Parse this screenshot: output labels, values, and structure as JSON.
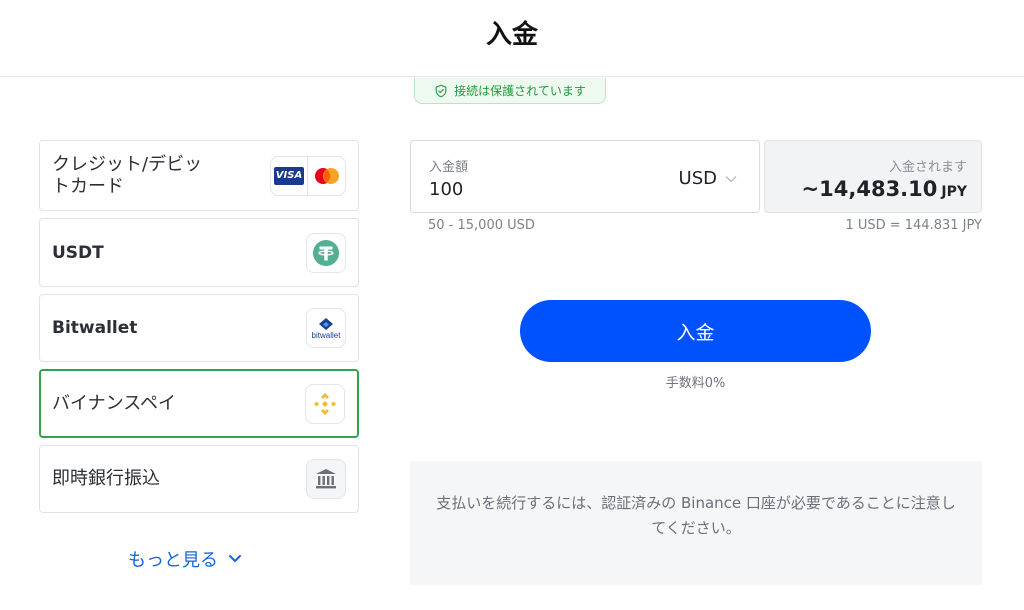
{
  "header": {
    "title": "入金"
  },
  "security": {
    "text": "接続は保護されています"
  },
  "methods": [
    {
      "label": "クレジット/デビットカード",
      "line1": "クレジット/デビッ",
      "line2": "トカード",
      "logos": [
        "visa-logo",
        "mastercard-logo"
      ]
    },
    {
      "label": "USDT",
      "logo": "tether-logo"
    },
    {
      "label": "Bitwallet",
      "logo": "bitwallet-logo",
      "logo_text": "bitwallet"
    },
    {
      "label": "バイナンスペイ",
      "logo": "binance-logo",
      "selected": true
    },
    {
      "label": "即時銀行振込",
      "logo": "bank-icon"
    }
  ],
  "cards": {
    "visa_text": "VISA"
  },
  "more": {
    "label": "もっと見る"
  },
  "amount": {
    "label": "入金額",
    "value": "100",
    "currency": "USD",
    "range": "50 - 15,000 USD"
  },
  "receive": {
    "label": "入金されます",
    "value": "~14,483.10",
    "unit": "JPY",
    "rate": "1 USD = 144.831 JPY"
  },
  "deposit_button": {
    "label": "入金"
  },
  "fee": {
    "text": "手数料0%"
  },
  "notice": {
    "text": "支払いを続行するには、認証済みの Binance 口座が必要であることに注意してください。"
  },
  "colors": {
    "accent": "#0052ff",
    "selected_border": "#2ea44f",
    "secure_green": "#1f9b3a"
  }
}
